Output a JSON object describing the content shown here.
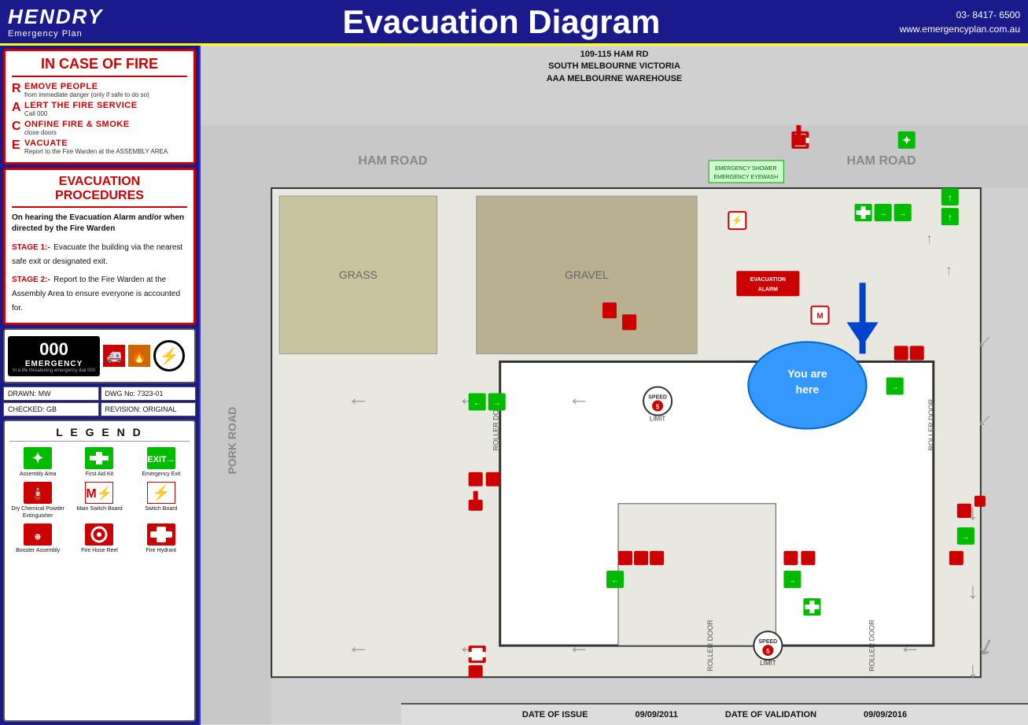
{
  "header": {
    "logo_name": "HENDRY",
    "logo_sub": "Emergency Plan",
    "title": "Evacuation Diagram",
    "contact_line1": "03-  8417- 6500",
    "contact_line2": "www.emergencyplan.com.au"
  },
  "fire_section": {
    "title": "IN CASE OF FIRE",
    "items": [
      {
        "letter": "R",
        "main": "EMOVE PEOPLE",
        "sub": "from immediate danger (only if safe to do so)"
      },
      {
        "letter": "A",
        "main": "LERT THE FIRE SERVICE",
        "sub": "Call 000"
      },
      {
        "letter": "C",
        "main": "ONFINE FIRE & SMOKE",
        "sub": "close doors"
      },
      {
        "letter": "E",
        "main": "VACUATE",
        "sub": "Report to the Fire Warden at the ASSEMBLY AREA"
      }
    ]
  },
  "evac_section": {
    "title": "EVACUATION\nPROCEDURES",
    "intro": "On hearing the Evacuation Alarm and/or when directed by the Fire Warden",
    "stage1_label": "STAGE 1:-",
    "stage1_text": "Evacuate the building via the nearest safe exit or designated exit.",
    "stage2_label": "STAGE 2:-",
    "stage2_text": "Report to the Fire Warden at the Assembly Area to ensure everyone is accounted for."
  },
  "emergency": {
    "number": "000",
    "word": "EMERGENCY",
    "sub": "In a life threatening emergency dial 000"
  },
  "info_grid": {
    "drawn_label": "DRAWN: MW",
    "dwg_label": "DWG No: 7323-01",
    "checked_label": "CHECKED: GB",
    "revision_label": "REVISION: ORIGINAL"
  },
  "legend": {
    "title": "L E G E N D",
    "items": [
      {
        "label": "Assembly Area",
        "type": "assembly"
      },
      {
        "label": "First Aid Kit",
        "type": "firstaid"
      },
      {
        "label": "Emergency Exit",
        "type": "exit"
      },
      {
        "label": "Dry Chemical Powder Extinguisher",
        "type": "extinguisher"
      },
      {
        "label": "Main Switch Board",
        "type": "switchboard"
      },
      {
        "label": "Switch Board",
        "type": "switchboard2"
      },
      {
        "label": "Booster Assembly",
        "type": "booster"
      },
      {
        "label": "Fire Hose Reel",
        "type": "hosereel"
      },
      {
        "label": "Fire Hydrant",
        "type": "hydrant"
      }
    ]
  },
  "address": {
    "line1": "109-115 HAM RD",
    "line2": "SOUTH MELBOURNE VICTORIA",
    "line3": "AAA MELBOURNE WAREHOUSE"
  },
  "footer": {
    "issue_label": "DATE OF ISSUE",
    "issue_date": "09/09/2011",
    "validation_label": "DATE OF VALIDATION",
    "validation_date": "09/09/2016"
  },
  "map": {
    "road_left": "HAM ROAD",
    "road_right": "HAM ROAD",
    "road_bottom": "PORK ROAD",
    "speed_limit": "SPEED 5 LIMIT",
    "roller_door_labels": [
      "ROLLER DOOR",
      "ROLLER DOOR",
      "ROLLER DOOR"
    ],
    "evacuation_alarm": "EVACUATION ALARM",
    "emergency_shower": "EMERGENCY SHOWER\nEMERGENCY EYEWASH",
    "you_are_here": "You are here"
  }
}
